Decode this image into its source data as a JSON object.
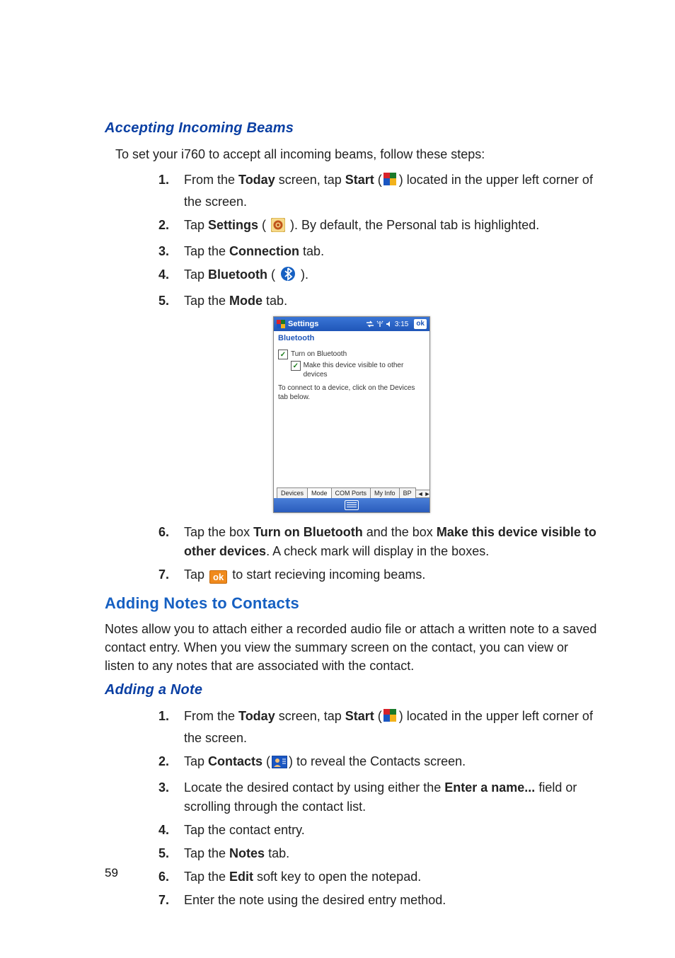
{
  "page_number": "59",
  "section1": {
    "title": "Accepting Incoming Beams",
    "intro": "To set your i760 to accept all incoming beams, follow these steps:",
    "steps": {
      "1": {
        "pre": "From the ",
        "b1": "Today",
        "mid1": " screen, tap ",
        "b2": "Start",
        "mid2": " (",
        "post": ") located in the upper left corner of the screen."
      },
      "2": {
        "pre": "Tap ",
        "b1": "Settings",
        "mid1": " ( ",
        "post": " ). By default, the Personal tab is highlighted."
      },
      "3": {
        "pre": "Tap the ",
        "b1": "Connection",
        "post": " tab."
      },
      "4": {
        "pre": "Tap ",
        "b1": "Bluetooth",
        "mid1": " ( ",
        "post": " )."
      },
      "5": {
        "pre": "Tap the ",
        "b1": "Mode",
        "post": " tab."
      },
      "6": {
        "pre": "Tap the box ",
        "b1": "Turn on Bluetooth",
        "mid1": " and the box ",
        "b2": "Make this device visible to other devices",
        "post": ".  A check mark will display in the boxes."
      },
      "7": {
        "pre": "Tap  ",
        "post": "  to start recieving incoming beams."
      }
    }
  },
  "screenshot": {
    "titlebar": {
      "app": "Settings",
      "time": "3:15",
      "ok": "ok"
    },
    "section": "Bluetooth",
    "check1": "Turn on Bluetooth",
    "check2": "Make this device visible to other devices",
    "hint": "To connect to a device, click on the Devices tab below.",
    "tabs": {
      "t1": "Devices",
      "t2": "Mode",
      "t3": "COM Ports",
      "t4": "My Info",
      "t5": "BP"
    }
  },
  "section2": {
    "title": "Adding Notes to Contacts",
    "para": "Notes allow you to attach either a recorded audio file or attach a written note to a saved contact entry. When you view the summary screen on the contact, you can view or listen to any notes that are associated with the contact."
  },
  "section3": {
    "title": "Adding a Note",
    "steps": {
      "1": {
        "pre": "From the ",
        "b1": "Today",
        "mid1": " screen, tap ",
        "b2": "Start",
        "mid2": " (",
        "post": ") located in the upper left corner of the screen."
      },
      "2": {
        "pre": "Tap ",
        "b1": "Contacts",
        "mid1": " (",
        "post": ") to reveal the Contacts screen."
      },
      "3": {
        "pre": "Locate the desired contact by using either the ",
        "b1": "Enter a name...",
        "post": " field or scrolling through the contact list."
      },
      "4": {
        "text": "Tap the contact entry."
      },
      "5": {
        "pre": "Tap the ",
        "b1": "Notes",
        "post": " tab."
      },
      "6": {
        "pre": "Tap the ",
        "b1": "Edit",
        "post": " soft key to open the notepad."
      },
      "7": {
        "text": "Enter the note using the desired entry method."
      }
    }
  },
  "icon_names": {
    "start": "start-flag-icon",
    "settings": "settings-gear-icon",
    "bluetooth": "bluetooth-icon",
    "contacts": "contacts-icon",
    "ok": "ok-button-icon"
  }
}
